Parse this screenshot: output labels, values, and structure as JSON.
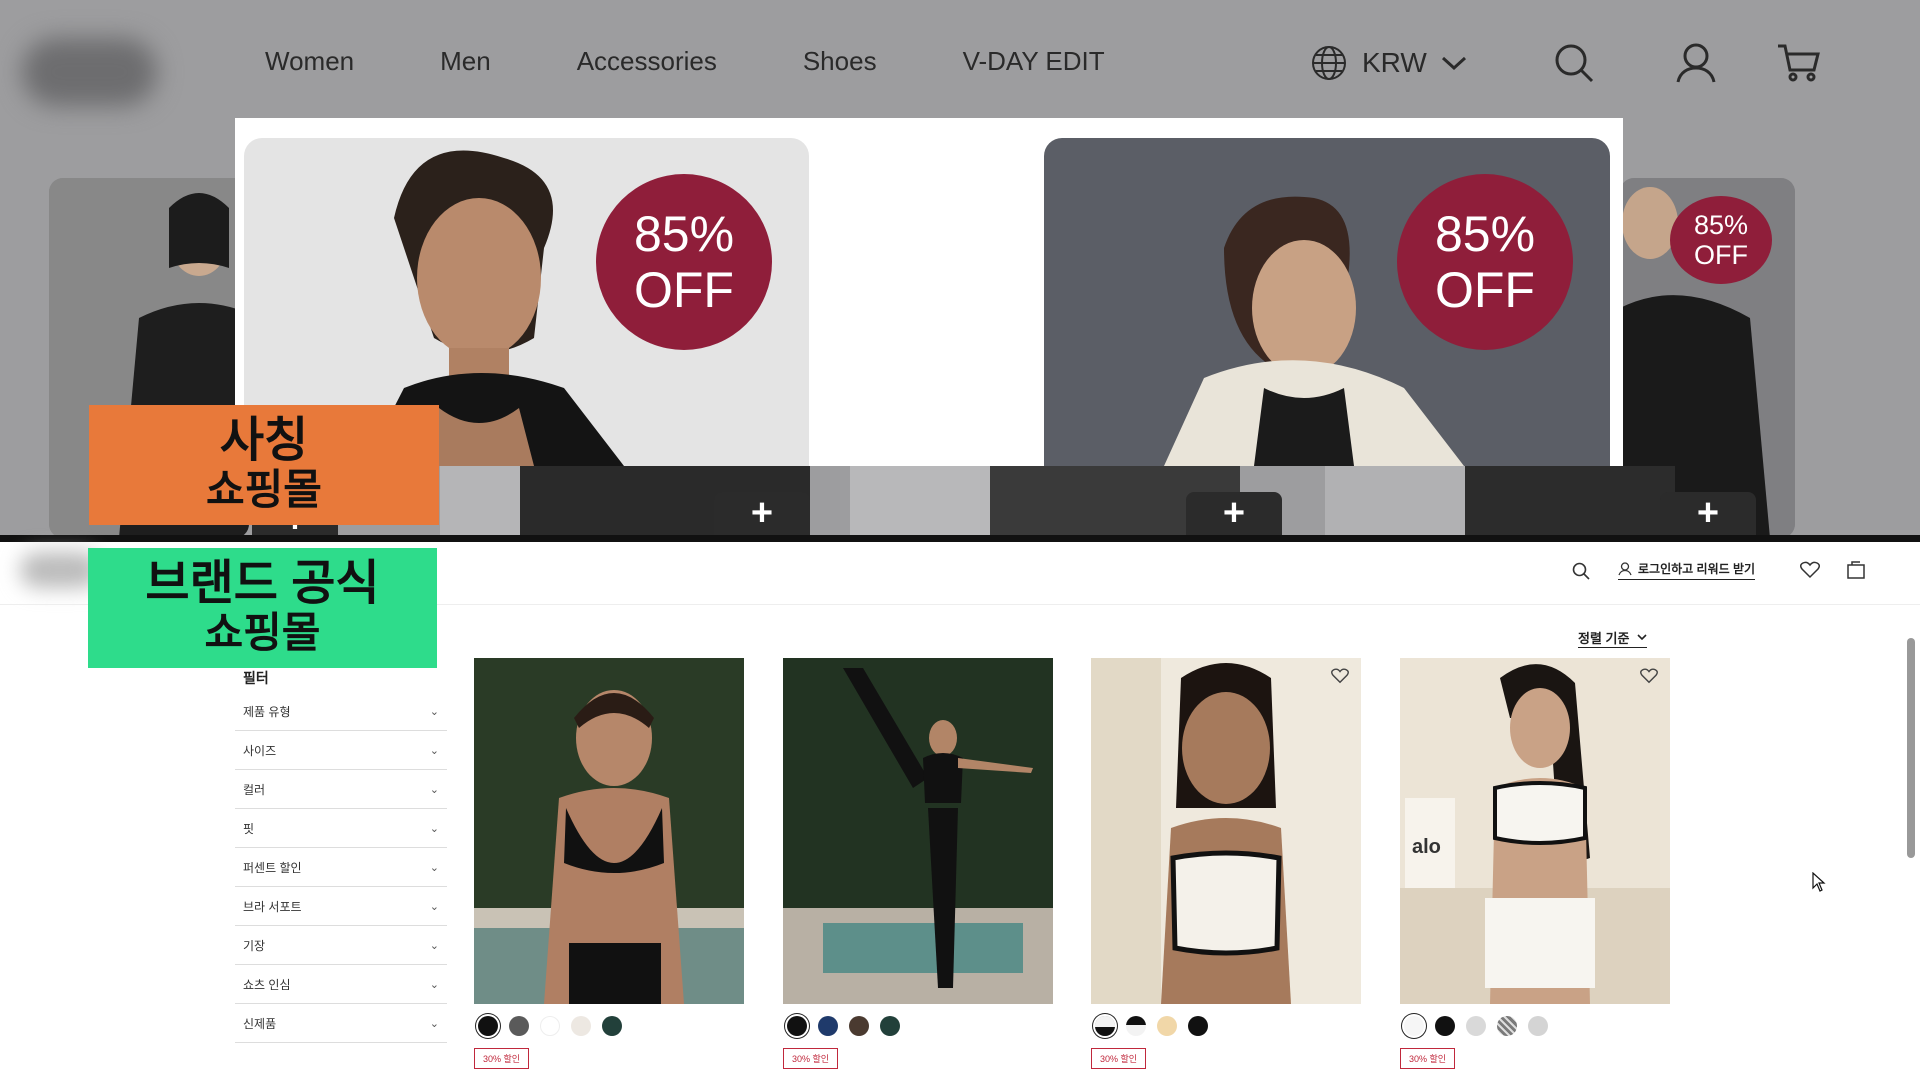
{
  "top_site": {
    "nav": [
      "Women",
      "Men",
      "Accessories",
      "Shoes",
      "V-DAY EDIT"
    ],
    "currency": "KRW",
    "badges": [
      {
        "pct": "85%",
        "off": "OFF"
      },
      {
        "pct": "85%",
        "off": "OFF"
      },
      {
        "pct": "85%",
        "off": "OFF"
      }
    ],
    "icons": [
      "globe-icon",
      "chevron-down-icon",
      "search-icon",
      "user-icon",
      "cart-icon",
      "plus-icon"
    ]
  },
  "labels": {
    "scam": {
      "line1": "사칭",
      "line2": "쇼핑몰"
    },
    "official": {
      "line1": "브랜드 공식",
      "line2": "쇼핑몰"
    }
  },
  "official_site": {
    "login_text": "로그인하고 리워드 받기",
    "sort_label": "정렬 기준",
    "filter_title": "필터",
    "filters": [
      "제품 유형",
      "사이즈",
      "컬러",
      "핏",
      "퍼센트 할인",
      "브라 서포트",
      "기장",
      "쇼츠 인심",
      "신제품"
    ],
    "products": [
      {
        "tag": "30% 할인",
        "swatches": [
          "#111111",
          "#5a5a5a",
          "#ffffff",
          "#ede8e2",
          "#22403a"
        ]
      },
      {
        "tag": "30% 할인",
        "swatches": [
          "#111111",
          "#1f3a6b",
          "#4a3a30",
          "#22403a"
        ]
      },
      {
        "tag": "30% 할인",
        "swatches": [
          "#f3f3f3",
          "#111111",
          "#f1d7a8",
          "#111111"
        ]
      },
      {
        "tag": "30% 할인",
        "swatches": [
          "#f6f6f6",
          "#111111",
          "#d9d9d9",
          "#7a7a7a",
          "#d4d4d4"
        ]
      }
    ]
  },
  "colors": {
    "badge": "#8f1e3a",
    "orange_label": "#e8793a",
    "green_label": "#2edc8b",
    "sale": "#c0283c"
  }
}
